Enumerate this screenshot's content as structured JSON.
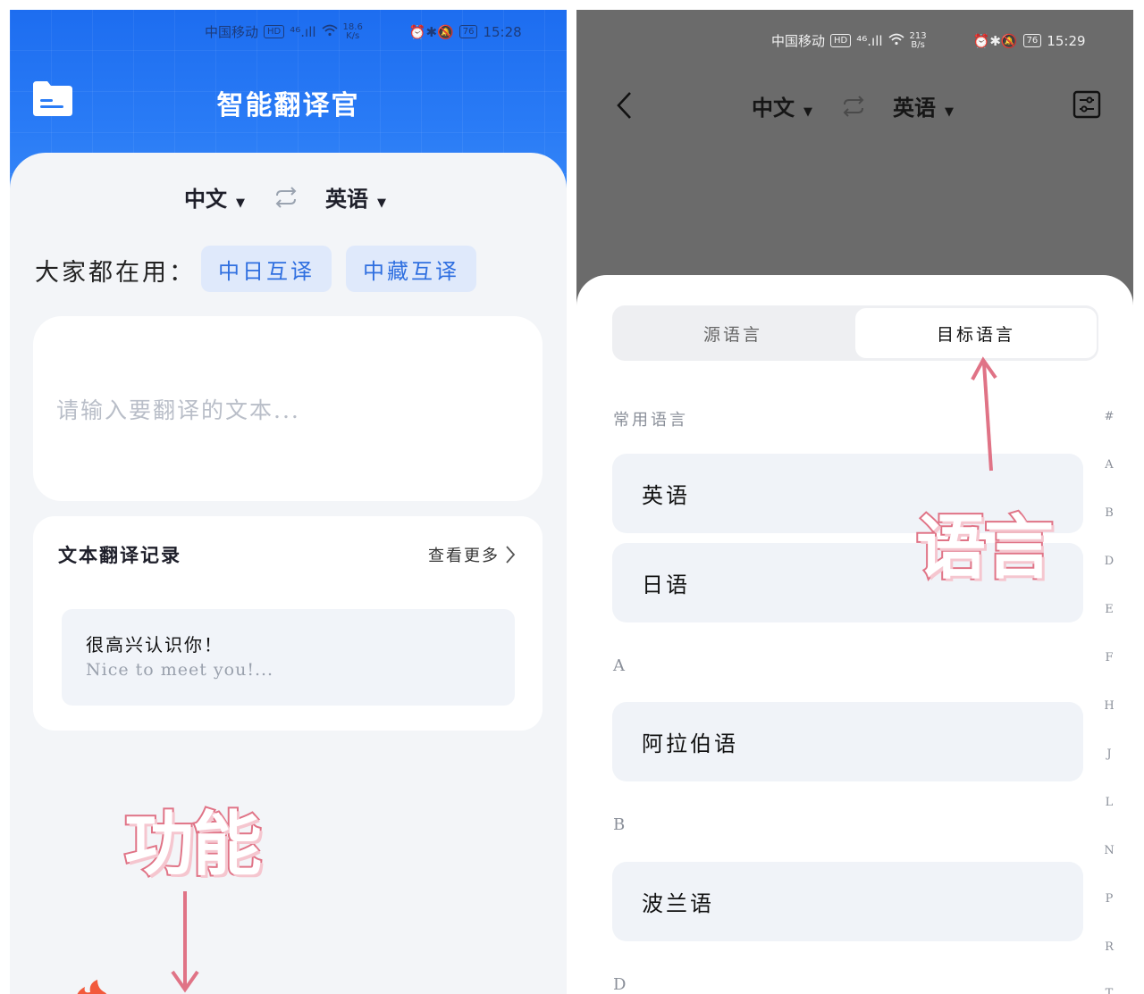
{
  "left": {
    "status": {
      "carrier": "中国移动",
      "hd": "HD",
      "net": "⁴⁶.ıll",
      "speed_value": "18.6",
      "speed_unit": "K/s",
      "icons": "⏰✱🔕",
      "battery": "76",
      "time": "15:28"
    },
    "app_title": "智能翻译官",
    "lang": {
      "source": "中文",
      "target": "英语"
    },
    "popular": {
      "label": "大家都在用：",
      "chips": [
        "中日互译",
        "中藏互译"
      ]
    },
    "input": {
      "placeholder": "请输入要翻译的文本..."
    },
    "history": {
      "title": "文本翻译记录",
      "more": "查看更多",
      "records": [
        {
          "source": "很高兴认识你！",
          "translation": "Nice to meet you!..."
        }
      ]
    },
    "annotation": "功能",
    "colors": {
      "hero": "#2a7cf6",
      "chip_bg": "#dfe9fb",
      "chip_text": "#2f6fe0",
      "annotation_stroke": "#e07386"
    }
  },
  "right": {
    "status": {
      "carrier": "中国移动",
      "hd": "HD",
      "net": "⁴⁶.ıll",
      "speed_value": "213",
      "speed_unit": "B/s",
      "icons": "⏰✱🔕",
      "battery": "76",
      "time": "15:29"
    },
    "lang": {
      "source": "中文",
      "target": "英语"
    },
    "tabs": {
      "source": "源语言",
      "target": "目标语言",
      "selected": "目标语言"
    },
    "sections": {
      "common": "常用语言",
      "a": "A",
      "b": "B",
      "d": "D"
    },
    "languages": {
      "common": [
        "英语",
        "日语"
      ],
      "a": [
        "阿拉伯语"
      ],
      "b": [
        "波兰语"
      ]
    },
    "index": [
      "#",
      "A",
      "B",
      "D",
      "E",
      "F",
      "H",
      "J",
      "L",
      "N",
      "P",
      "R",
      "T"
    ],
    "annotation": "语言",
    "colors": {
      "overlay": "#6b6b6b",
      "row_bg": "#f0f3f8",
      "annotation_stroke": "#e07386"
    }
  }
}
